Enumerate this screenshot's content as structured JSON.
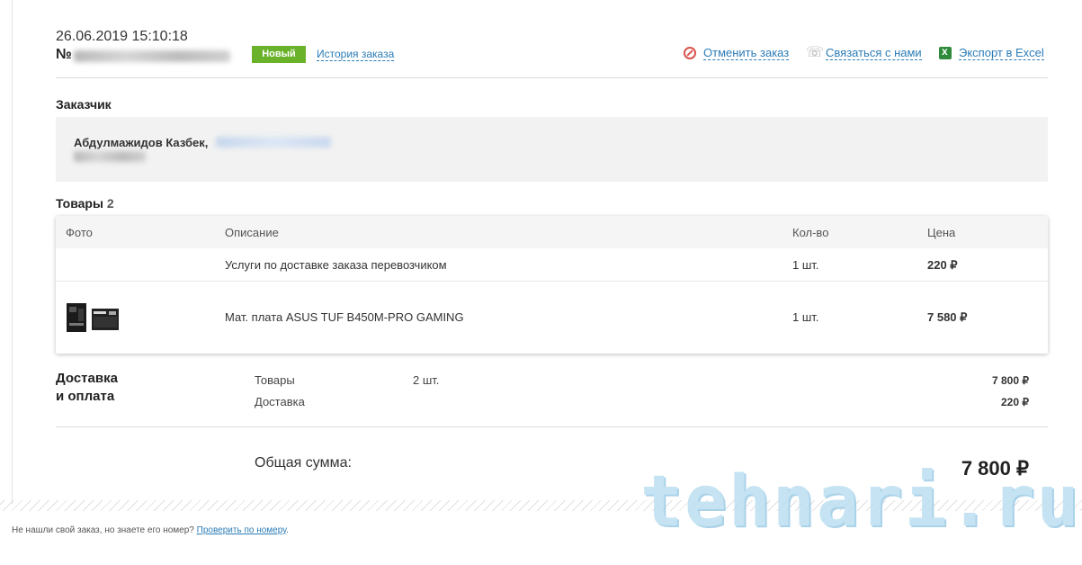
{
  "order": {
    "datetime": "26.06.2019 15:10:18",
    "number_prefix": "№",
    "status": "Новый",
    "history_link": "История заказа"
  },
  "actions": {
    "cancel": "Отменить заказ",
    "contact": "Связаться с нами",
    "export": "Экспорт в Excel"
  },
  "customer": {
    "title": "Заказчик",
    "name": "Абдулмажидов Казбек,"
  },
  "goods": {
    "title": "Товары",
    "count": "2",
    "headers": {
      "photo": "Фото",
      "description": "Описание",
      "qty": "Кол-во",
      "price": "Цена"
    },
    "rows": [
      {
        "description": "Услуги по доставке заказа перевозчиком",
        "qty": "1 шт.",
        "price": "220 ₽"
      },
      {
        "description": "Мат. плата ASUS TUF B450M-PRO GAMING",
        "qty": "1 шт.",
        "price": "7 580 ₽"
      }
    ]
  },
  "delivery": {
    "title_line1": "Доставка",
    "title_line2": "и оплата",
    "items_label": "Товары",
    "items_qty": "2 шт.",
    "items_sum": "7 800 ₽",
    "shipping_label": "Доставка",
    "shipping_sum": "220 ₽",
    "total_label": "Общая сумма:",
    "total": "7 800 ₽"
  },
  "footer": {
    "text": "Не нашли свой заказ, но знаете его номер? ",
    "link": "Проверить по номеру",
    "end": "."
  },
  "watermark": "tehnari.ru",
  "colors": {
    "status_badge": "#6ab22a",
    "link": "#2c7cb7",
    "cancel_icon": "#d9534f",
    "excel_icon": "#2f8a3c"
  }
}
